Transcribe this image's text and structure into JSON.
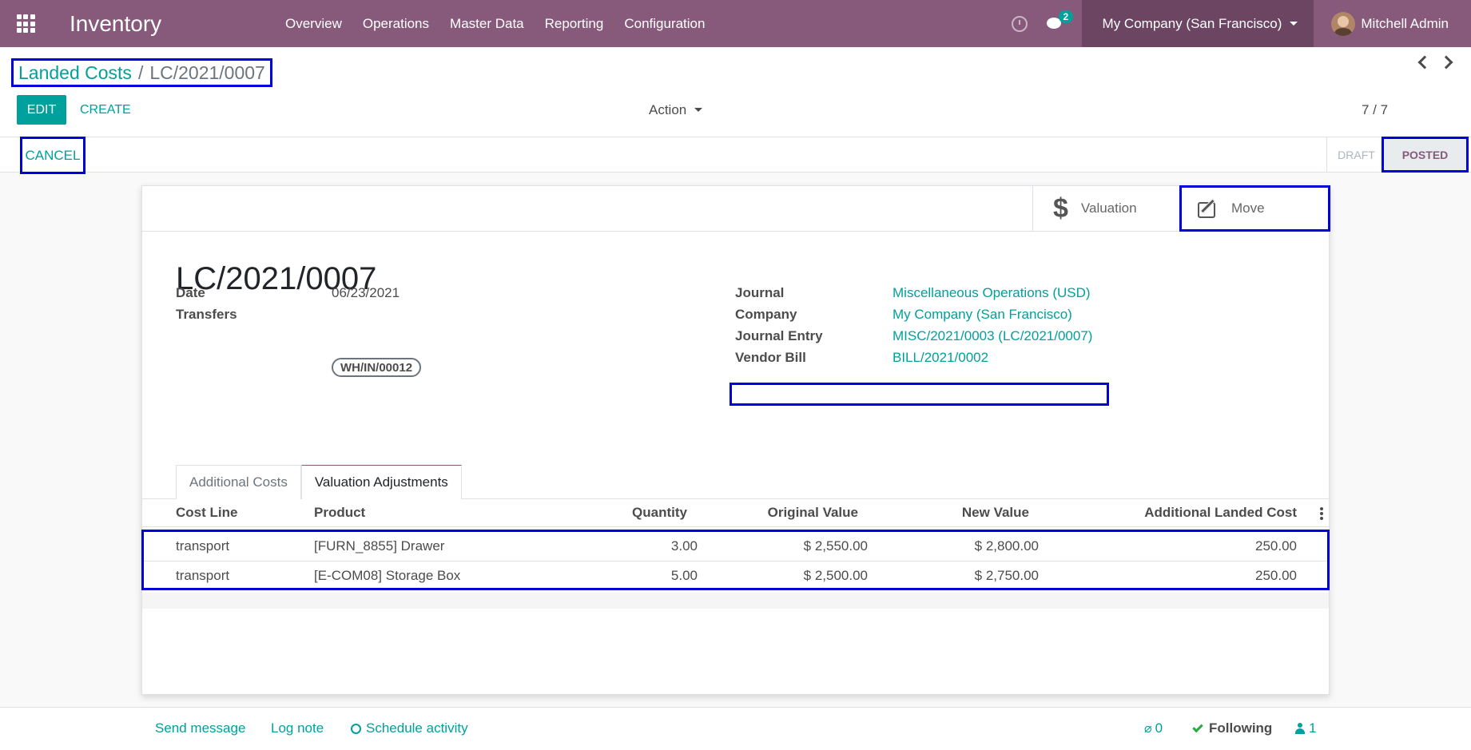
{
  "navbar": {
    "app_title": "Inventory",
    "menu": [
      "Overview",
      "Operations",
      "Master Data",
      "Reporting",
      "Configuration"
    ],
    "messages_count": "2",
    "company": "My Company (San Francisco)",
    "user": "Mitchell Admin"
  },
  "control": {
    "breadcrumb_parent": "Landed Costs",
    "breadcrumb_separator": "/",
    "breadcrumb_current": "LC/2021/0007",
    "edit_label": "EDIT",
    "create_label": "CREATE",
    "action_label": "Action",
    "pager": "7 / 7"
  },
  "status": {
    "cancel_label": "CANCEL",
    "stages": [
      "DRAFT",
      "POSTED"
    ],
    "current_stage": "POSTED"
  },
  "smart_buttons": {
    "valuation": "Valuation",
    "move": "Move"
  },
  "record": {
    "title": "LC/2021/0007",
    "date_label": "Date",
    "date": "06/23/2021",
    "transfers_label": "Transfers",
    "transfers": "WH/IN/00012",
    "journal_label": "Journal",
    "journal": "Miscellaneous Operations (USD)",
    "company_label": "Company",
    "company": "My Company (San Francisco)",
    "journal_entry_label": "Journal Entry",
    "journal_entry": "MISC/2021/0003 (LC/2021/0007)",
    "vendor_bill_label": "Vendor Bill",
    "vendor_bill": "BILL/2021/0002"
  },
  "tabs": [
    "Additional Costs",
    "Valuation Adjustments"
  ],
  "active_tab": "Valuation Adjustments",
  "table": {
    "headers": [
      "Cost Line",
      "Product",
      "Quantity",
      "Original Value",
      "New Value",
      "Additional Landed Cost"
    ],
    "rows": [
      [
        "transport",
        "[FURN_8855] Drawer",
        "3.00",
        "$ 2,550.00",
        "$ 2,800.00",
        "250.00"
      ],
      [
        "transport",
        "[E-COM08] Storage Box",
        "5.00",
        "$ 2,500.00",
        "$ 2,750.00",
        "250.00"
      ]
    ]
  },
  "chatter": {
    "send_message": "Send message",
    "log_note": "Log note",
    "schedule_activity": "Schedule activity",
    "attachments": "0",
    "following": "Following",
    "followers": "1"
  },
  "colors": {
    "navbar": "#875a7b",
    "accent": "#00a09d",
    "highlight_box": "#0000d9"
  }
}
